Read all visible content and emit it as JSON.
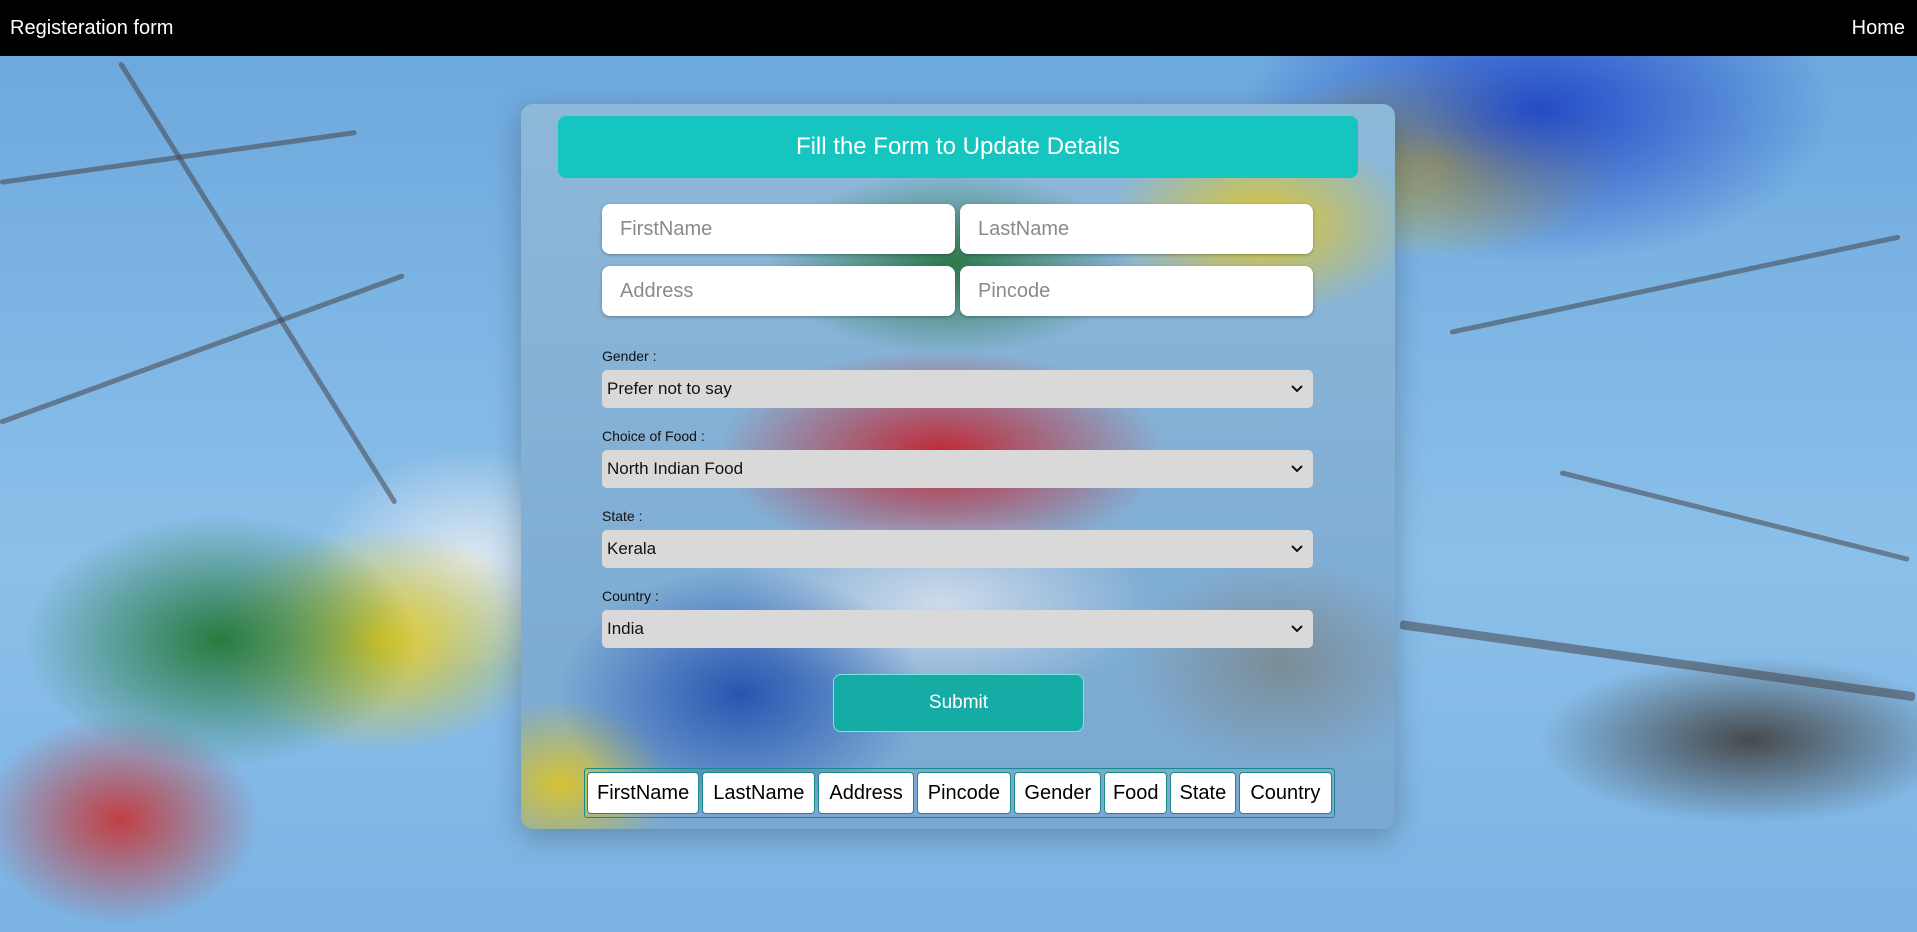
{
  "navbar": {
    "brand": "Registeration form",
    "home_link": "Home"
  },
  "form": {
    "title": "Fill the Form to Update Details",
    "first_name": {
      "placeholder": "FirstName",
      "value": ""
    },
    "last_name": {
      "placeholder": "LastName",
      "value": ""
    },
    "address": {
      "placeholder": "Address",
      "value": ""
    },
    "pincode": {
      "placeholder": "Pincode",
      "value": ""
    },
    "gender": {
      "label": "Gender :",
      "selected": "Prefer not to say"
    },
    "food": {
      "label": "Choice of Food :",
      "selected": "North Indian Food"
    },
    "state": {
      "label": "State :",
      "selected": "Kerala"
    },
    "country": {
      "label": "Country :",
      "selected": "India"
    },
    "submit_label": "Submit"
  },
  "table": {
    "headers": [
      "FirstName",
      "LastName",
      "Address",
      "Pincode",
      "Gender",
      "Food",
      "State",
      "Country"
    ]
  },
  "icons": {
    "select_arrow": "chevron-down-icon"
  },
  "colors": {
    "navbar_bg": "#000000",
    "header_accent": "#17c5c0",
    "submit_bg": "#16aca6",
    "select_bg": "#d9d9d9"
  }
}
